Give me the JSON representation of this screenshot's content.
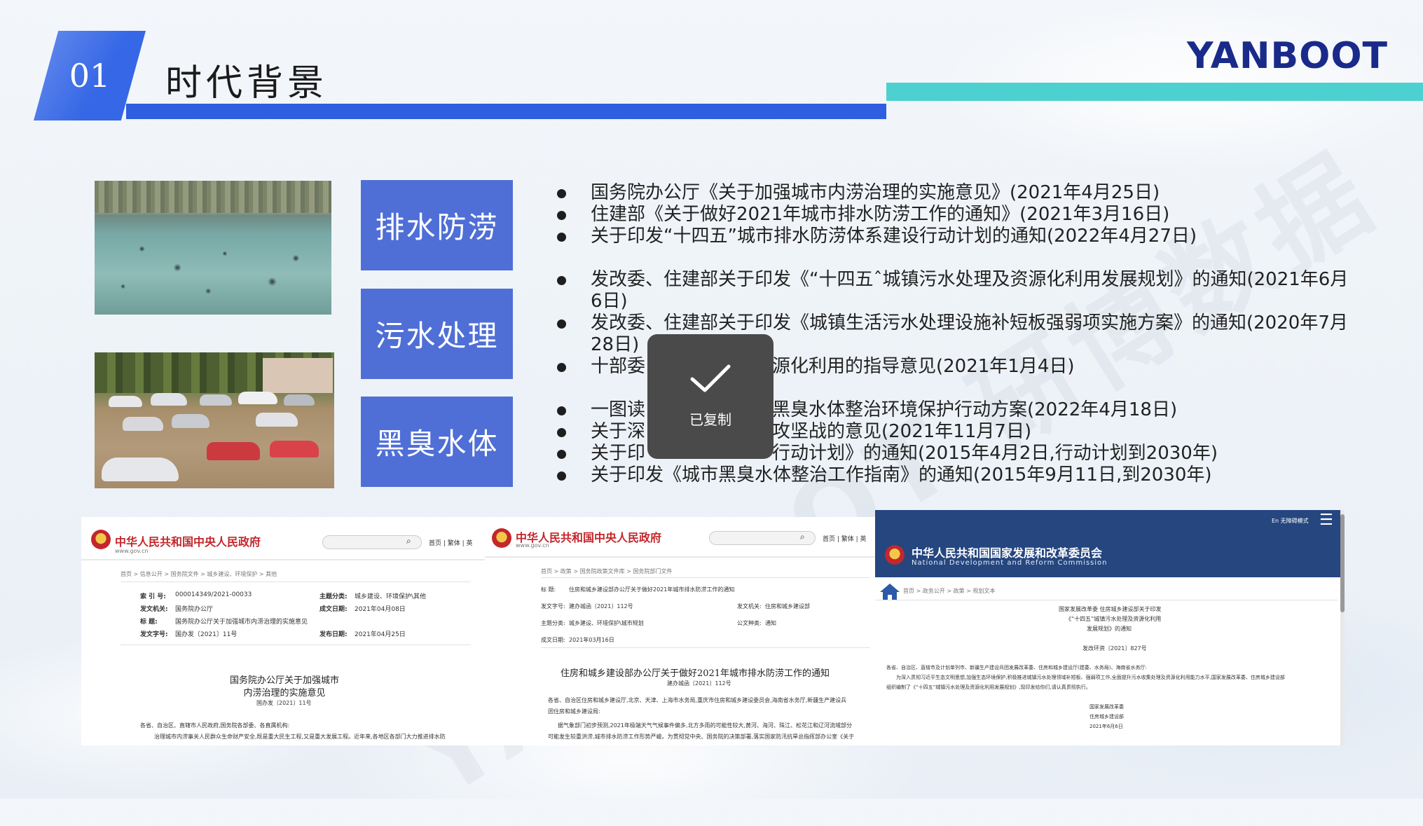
{
  "header": {
    "section_number": "01",
    "title": "时代背景",
    "brand_logo": "YANBOOT"
  },
  "categories": [
    {
      "label": "排水防涝"
    },
    {
      "label": "污水处理"
    },
    {
      "label": "黑臭水体"
    }
  ],
  "bullets": [
    "国务院办公厅《关于加强城市内涝治理的实施意见》(2021年4月25日)",
    "住建部《关于做好2021年城市排水防涝工作的通知》(2021年3月16日)",
    "关于印发“十四五”城市排水防涝体系建设行动计划的通知(2022年4月27日)",
    "发改委、住建部关于印发《“十四五ˆ城镇污水处理及资源化利用发展规划》的通知(2021年6月6日)",
    "发改委、住建部关于印发《城镇生活污水处理设施补短板强弱项实施方案》的通知(2020年7月28日)",
    "十部委",
    "源化利用的指导意见(2021年1月4日)",
    "一图读",
    "黑臭水体整治环境保护行动方案(2022年4月18日)",
    "关于深",
    "攻坚战的意见(2021年11月7日)",
    "关于印",
    "行动计划》的通知(2015年4月2日,行动计划到2030年)",
    "关于印发《城市黑臭水体整治工作指南》的通知(2015年9月11日,到2030年)"
  ],
  "toast": {
    "label": "已复制",
    "icon": "checkmark-icon"
  },
  "screenshot_gov1": {
    "site_name": "中华人民共和国中央人民政府",
    "url": "www.gov.cn",
    "nav": "首页 | 繁体 | 英",
    "breadcrumb": "首页 > 信息公开 > 国务院文件 > 城乡建设、环境保护 > 其他",
    "meta": [
      [
        "索 引 号:",
        "000014349/2021-00033",
        "主题分类:",
        "城乡建设、环境保护\\其他"
      ],
      [
        "发文机关:",
        "国务院办公厅",
        "成文日期:",
        "2021年04月08日"
      ],
      [
        "标    题:",
        "国务院办公厅关于加强城市内涝治理的实施意见",
        "",
        ""
      ],
      [
        "发文字号:",
        "国办发〔2021〕11号",
        "发布日期:",
        "2021年04月25日"
      ]
    ],
    "doc_title_line1": "国务院办公厅关于加强城市",
    "doc_title_line2": "内涝治理的实施意见",
    "doc_number": "国办发〔2021〕11号",
    "body_line1": "各省、自治区、直辖市人民政府,国务院各部委、各直属机构:",
    "body_line2": "治理城市内涝事关人民群众生命财产安全,既是重大民生工程,又是重大发展工程。近年来,各地区各部门大力推进排水防"
  },
  "screenshot_gov2": {
    "site_name": "中华人民共和国中央人民政府",
    "url": "www.gov.cn",
    "nav": "首页 | 繁体 | 英",
    "breadcrumb": "首页 > 政策 > 国务院政策文件库 > 国务院部门文件",
    "meta": [
      [
        "标    题:",
        "住房和城乡建设部办公厅关于做好2021年城市排水防涝工作的通知",
        "",
        ""
      ],
      [
        "发文字号:",
        "建办城函〔2021〕112号",
        "发文机关:",
        "住房和城乡建设部"
      ],
      [
        "主题分类:",
        "城乡建设、环境保护\\城市规划",
        "公文种类:",
        "通知"
      ],
      [
        "成文日期:",
        "2021年03月16日",
        "",
        ""
      ]
    ],
    "doc_title": "住房和城乡建设部办公厅关于做好2021年城市排水防涝工作的通知",
    "doc_number": "建办城函〔2021〕112号",
    "body_line1": "各省、自治区住房和城乡建设厅,北京、天津、上海市水务局,重庆市住房和城乡建设委员会,海南省水务厅,新疆生产建设兵",
    "body_line2": "团住房和城乡建设局:",
    "body_line3": "据气象部门初步预测,2021年极端天气气候事件偏多,北方多雨的可能性较大,黄河、海河、珠江、松花江和辽河流域部分",
    "body_line4": "可能发生较重洪涝,城市排水防涝工作形势严峻。为贯彻党中央、国务院的决策部署,落实国家防汛抗旱总指挥部办公室《关于"
  },
  "screenshot_ndrc": {
    "site_name": "中华人民共和国国家发展和改革委员会",
    "site_name_en": "National Development and Reform Commission",
    "top_links": "En  无障碍模式",
    "breadcrumb": "首页 > 政务公开 > 政策 > 规划文本",
    "heading_line1": "国家发展改革委 住房城乡建设部关于印发",
    "heading_line2": "《“十四五”城镇污水处理及资源化利用",
    "heading_line3": "发展规划》的通知",
    "doc_number": "发改环资〔2021〕827号",
    "body_line1": "各省、自治区、直辖市及计划单列市、新疆生产建设兵团发展改革委、住房和城乡建设厅(建委、水务局)、海南省水务厅:",
    "body_line2": "为深入贯彻习近平生态文明思想,加强生态环境保护,积极推进城镇污水处理领域补短板、强弱项工作,全面提升污水收集处理及资源化利用能力水平,国家发展改革委、住房城乡建设部",
    "body_line3": "组织编制了《“十四五”城镇污水处理及资源化利用发展规划》,现印发给你们,请认真贯彻执行。",
    "signature1": "国家发展改革委",
    "signature2": "住房城乡建设部",
    "signature_date": "2021年6月6日"
  },
  "watermark": "YANBOOT 研博数据"
}
